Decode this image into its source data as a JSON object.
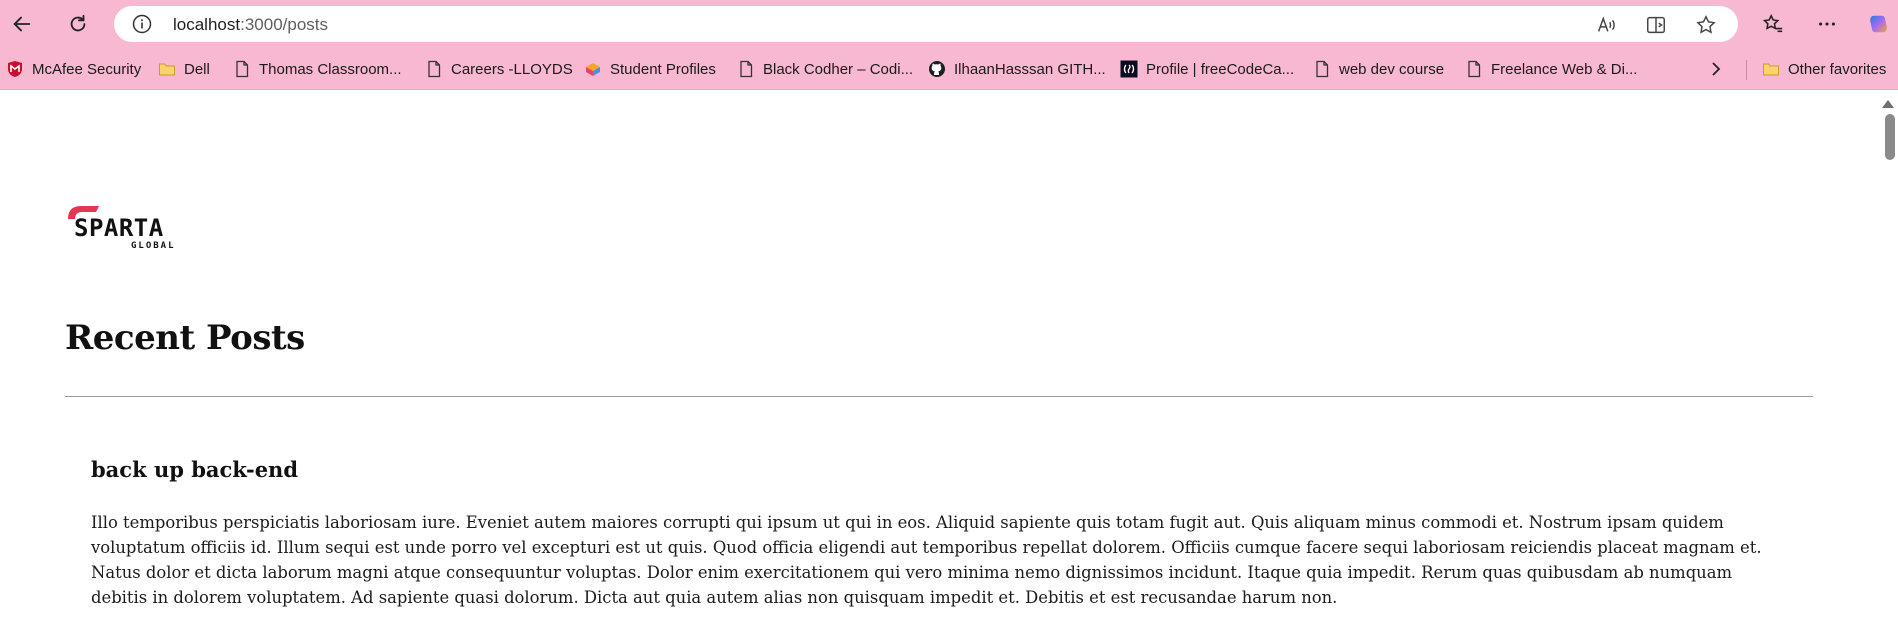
{
  "browser": {
    "url_host": "localhost",
    "url_path": ":3000/posts"
  },
  "bookmarks": [
    {
      "label": "McAfee Security",
      "icon": "mcafee-icon"
    },
    {
      "label": "Dell",
      "icon": "folder-icon"
    },
    {
      "label": "Thomas Classroom...",
      "icon": "page-icon"
    },
    {
      "label": "Careers -LLOYDS",
      "icon": "page-icon"
    },
    {
      "label": "Student Profiles",
      "icon": "profiles-icon"
    },
    {
      "label": "Black Codher – Codi...",
      "icon": "page-icon"
    },
    {
      "label": "IlhaanHasssan GITH...",
      "icon": "github-icon"
    },
    {
      "label": "Profile | freeCodeCa...",
      "icon": "freecodecamp-icon"
    },
    {
      "label": "web dev course",
      "icon": "page-icon"
    },
    {
      "label": "Freelance Web & Di...",
      "icon": "page-icon"
    },
    {
      "label": "Other favorites",
      "icon": "folder-icon"
    }
  ],
  "page": {
    "logo_word": "SPARTA",
    "logo_sub": "GLOBAL",
    "heading": "Recent Posts",
    "posts": [
      {
        "title": "back up back-end",
        "body": "Illo temporibus perspiciatis laboriosam iure. Eveniet autem maiores corrupti qui ipsum ut qui in eos. Aliquid sapiente quis totam fugit aut. Quis aliquam minus commodi et. Nostrum ipsam quidem voluptatum officiis id. Illum sequi est unde porro vel excepturi est ut quis. Quod officia eligendi aut temporibus repellat dolorem. Officiis cumque facere sequi laboriosam reiciendis placeat magnam et. Natus dolor et dicta laborum magni atque consequuntur voluptas. Dolor enim exercitationem qui vero minima nemo dignissimos incidunt. Itaque quia impedit. Rerum quas quibusdam ab numquam debitis in dolorem voluptatem. Ad sapiente quasi dolorum. Dicta aut quia autem alias non quisquam impedit et. Debitis et est recusandae harum non."
      }
    ]
  },
  "colors": {
    "toolbar_bg": "#f9b8d2",
    "logo_accent": "#e5354f"
  }
}
